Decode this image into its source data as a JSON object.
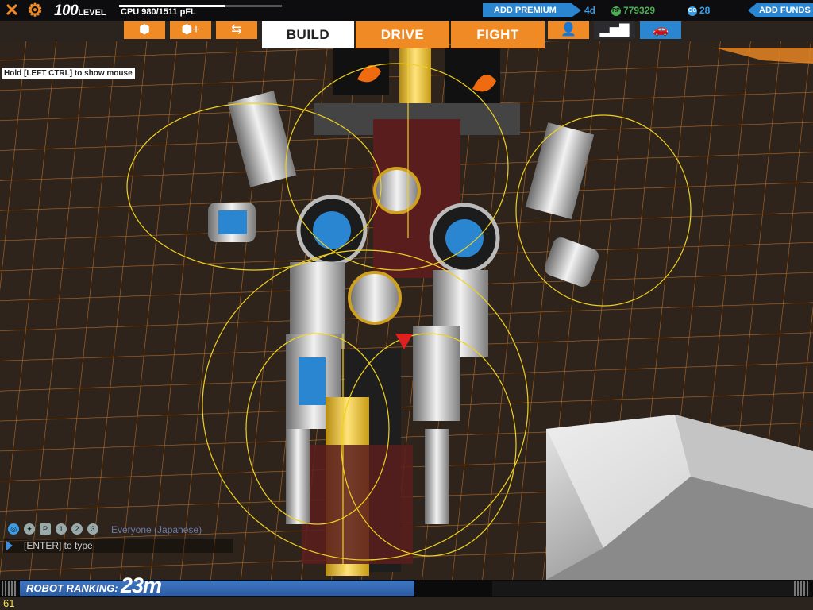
{
  "top": {
    "level": "100",
    "level_label": "LEVEL",
    "cpu": "CPU 980/1511 pFL",
    "cpu_fraction": 0.65,
    "add_premium": "ADD PREMIUM",
    "premium_days": "4d",
    "rp_icon": "RP",
    "rp": "779329",
    "gc_icon": "GC",
    "gc": "28",
    "add_funds": "ADD FUNDS"
  },
  "tabs": {
    "build": "BUILD",
    "drive": "DRIVE",
    "fight": "FIGHT"
  },
  "hint": "Hold [LEFT CTRL] to show mouse",
  "chat": {
    "channel": "Everyone (Japanese)",
    "placeholder": "[ENTER] to type",
    "icons": [
      "globe-icon",
      "friends-icon",
      "party-icon",
      "player-1-icon",
      "player-2-icon",
      "player-3-icon"
    ]
  },
  "ranking": {
    "label": "ROBOT RANKING:",
    "value": "23m",
    "fraction": 0.49
  },
  "fps": "61",
  "colors": {
    "accent_orange": "#f08a24",
    "accent_blue": "#2b86d2",
    "grid_line": "#e0892c",
    "gizmo_yellow": "#f0d020"
  }
}
